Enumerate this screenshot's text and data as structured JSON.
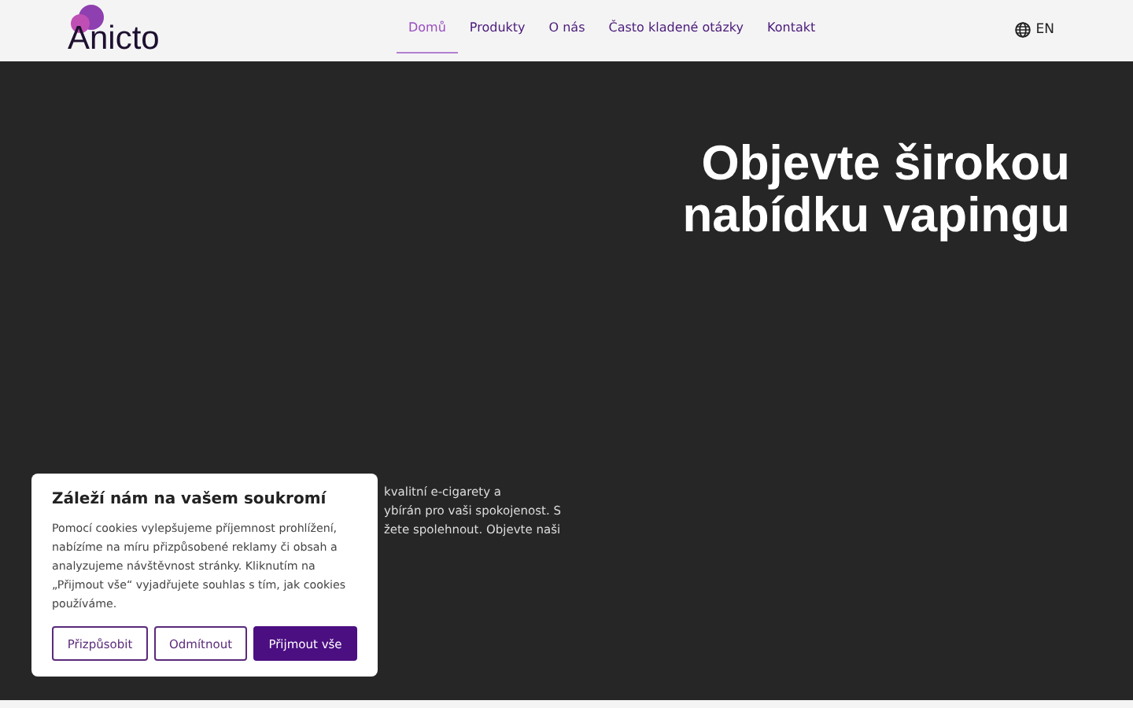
{
  "header": {
    "logo": "Anicto",
    "nav": [
      {
        "label": "Domů",
        "selected": true
      },
      {
        "label": "Produkty",
        "selected": false
      },
      {
        "label": "O nás",
        "selected": false
      },
      {
        "label": "Často kladené otázky",
        "selected": false
      },
      {
        "label": "Kontakt",
        "selected": false
      }
    ],
    "language": "EN"
  },
  "hero": {
    "heading": "Objevte širokou nabídku vapingu",
    "text_lines": [
      "kvalitní e-cigarety a",
      "ybírán pro vaši spokojenost. S",
      "žete spolehnout. Objevte naši"
    ]
  },
  "cookie_dialog": {
    "title": "Záleží nám na vašem soukromí",
    "text": "Pomocí cookies vylepšujeme příjemnost prohlížení, nabízíme na míru přizpůsobené reklamy či obsah a analyzujeme návštěvnost stránky. Kliknutím na „Přijmout vše“ vyjadřujete souhlas s tím, jak cookies používáme.",
    "buttons": [
      {
        "label": "Přizpůsobit",
        "kind": "outline"
      },
      {
        "label": "Odmítnout",
        "kind": "outline"
      },
      {
        "label": "Přijmout vše",
        "kind": "primary"
      }
    ]
  }
}
